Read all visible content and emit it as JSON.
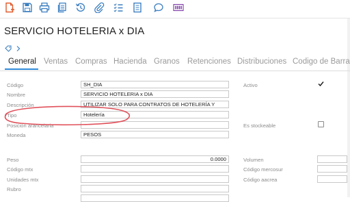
{
  "toolbar": {
    "icons": [
      "new-document-icon",
      "save-icon",
      "print-icon",
      "copy-icon",
      "history-icon",
      "attachment-icon",
      "checklist-icon",
      "report-icon",
      "comment-icon",
      "barcode-icon"
    ]
  },
  "title": "SERVICIO HOTELERIA x DIA",
  "tabs": [
    "General",
    "Ventas",
    "Compras",
    "Hacienda",
    "Granos",
    "Retenciones",
    "Distribuciones",
    "Codigo de Barras"
  ],
  "form": {
    "codigo": {
      "label": "Código",
      "value": "SH_DIA"
    },
    "nombre": {
      "label": "Nombre",
      "value": "SERVICIO HOTELERIA x DIA"
    },
    "descripcion": {
      "label": "Descripción",
      "value": "UTILIZAR SOLO PARA CONTRATOS DE HOTELERÍA Y"
    },
    "tipo": {
      "label": "Tipo",
      "value": "Hotelería"
    },
    "posicion": {
      "label": "Posición arancelaria",
      "value": ""
    },
    "moneda": {
      "label": "Moneda",
      "value": "PESOS"
    },
    "peso": {
      "label": "Peso",
      "value": "0.0000"
    },
    "codigo_mtx": {
      "label": "Código mtx",
      "value": ""
    },
    "unidades_mtx": {
      "label": "Unidades mtx",
      "value": ""
    },
    "rubro": {
      "label": "Rubro",
      "value": ""
    }
  },
  "right": {
    "activo": {
      "label": "Activo",
      "checked": true
    },
    "stockeable": {
      "label": "Es stockeable",
      "checked": false
    },
    "volumen": {
      "label": "Volumen",
      "value": ""
    },
    "mercosur": {
      "label": "Código mercosur",
      "value": ""
    },
    "aacrea": {
      "label": "Código aacrea",
      "value": ""
    }
  },
  "colors": {
    "accent": "#2e8ad8",
    "icon_blue": "#3c7fc1",
    "highlight_oval": "#e0505a",
    "new_icon": "#e05a2b",
    "barcode_icon": "#7d3aa6"
  }
}
